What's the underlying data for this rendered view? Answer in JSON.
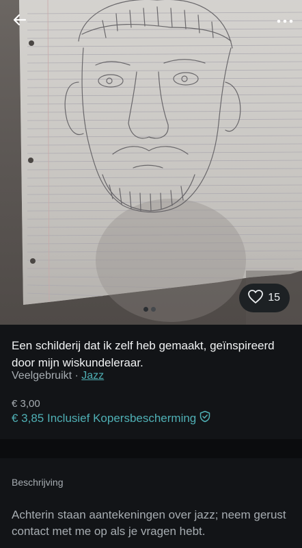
{
  "photo": {
    "alt_subject": "pencil sketch",
    "favorites_count": "15",
    "pager": {
      "total": 2,
      "active": 1
    }
  },
  "item": {
    "title": "Een schilderij dat ik zelf heb gemaakt, geïnspireerd door mijn wiskundeleraar.",
    "condition": "Veelgebruikt",
    "separator": " · ",
    "brand": "Jazz",
    "price": "€ 3,00",
    "price_total": "€ 3,85 Inclusief Kopersbescherming"
  },
  "description": {
    "heading": "Beschrijving",
    "text": "Achterin staan aantekeningen over jazz; neem gerust contact met me op als je vragen hebt."
  },
  "colors": {
    "accent": "#4fb0b5",
    "background": "#121417",
    "muted_text": "#a7adb2"
  },
  "icons": {
    "back": "arrow-left-icon",
    "more": "more-vertical-icon",
    "favorite": "heart-icon",
    "protection": "shield-check-icon"
  }
}
